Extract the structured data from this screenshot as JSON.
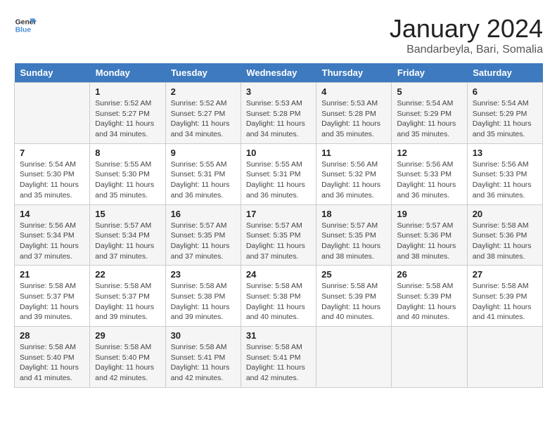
{
  "logo": {
    "line1": "General",
    "line2": "Blue"
  },
  "title": "January 2024",
  "location": "Bandarbeyla, Bari, Somalia",
  "days_header": [
    "Sunday",
    "Monday",
    "Tuesday",
    "Wednesday",
    "Thursday",
    "Friday",
    "Saturday"
  ],
  "weeks": [
    [
      {
        "day": "",
        "info": ""
      },
      {
        "day": "1",
        "info": "Sunrise: 5:52 AM\nSunset: 5:27 PM\nDaylight: 11 hours\nand 34 minutes."
      },
      {
        "day": "2",
        "info": "Sunrise: 5:52 AM\nSunset: 5:27 PM\nDaylight: 11 hours\nand 34 minutes."
      },
      {
        "day": "3",
        "info": "Sunrise: 5:53 AM\nSunset: 5:28 PM\nDaylight: 11 hours\nand 34 minutes."
      },
      {
        "day": "4",
        "info": "Sunrise: 5:53 AM\nSunset: 5:28 PM\nDaylight: 11 hours\nand 35 minutes."
      },
      {
        "day": "5",
        "info": "Sunrise: 5:54 AM\nSunset: 5:29 PM\nDaylight: 11 hours\nand 35 minutes."
      },
      {
        "day": "6",
        "info": "Sunrise: 5:54 AM\nSunset: 5:29 PM\nDaylight: 11 hours\nand 35 minutes."
      }
    ],
    [
      {
        "day": "7",
        "info": "Sunrise: 5:54 AM\nSunset: 5:30 PM\nDaylight: 11 hours\nand 35 minutes."
      },
      {
        "day": "8",
        "info": "Sunrise: 5:55 AM\nSunset: 5:30 PM\nDaylight: 11 hours\nand 35 minutes."
      },
      {
        "day": "9",
        "info": "Sunrise: 5:55 AM\nSunset: 5:31 PM\nDaylight: 11 hours\nand 36 minutes."
      },
      {
        "day": "10",
        "info": "Sunrise: 5:55 AM\nSunset: 5:31 PM\nDaylight: 11 hours\nand 36 minutes."
      },
      {
        "day": "11",
        "info": "Sunrise: 5:56 AM\nSunset: 5:32 PM\nDaylight: 11 hours\nand 36 minutes."
      },
      {
        "day": "12",
        "info": "Sunrise: 5:56 AM\nSunset: 5:33 PM\nDaylight: 11 hours\nand 36 minutes."
      },
      {
        "day": "13",
        "info": "Sunrise: 5:56 AM\nSunset: 5:33 PM\nDaylight: 11 hours\nand 36 minutes."
      }
    ],
    [
      {
        "day": "14",
        "info": "Sunrise: 5:56 AM\nSunset: 5:34 PM\nDaylight: 11 hours\nand 37 minutes."
      },
      {
        "day": "15",
        "info": "Sunrise: 5:57 AM\nSunset: 5:34 PM\nDaylight: 11 hours\nand 37 minutes."
      },
      {
        "day": "16",
        "info": "Sunrise: 5:57 AM\nSunset: 5:35 PM\nDaylight: 11 hours\nand 37 minutes."
      },
      {
        "day": "17",
        "info": "Sunrise: 5:57 AM\nSunset: 5:35 PM\nDaylight: 11 hours\nand 37 minutes."
      },
      {
        "day": "18",
        "info": "Sunrise: 5:57 AM\nSunset: 5:35 PM\nDaylight: 11 hours\nand 38 minutes."
      },
      {
        "day": "19",
        "info": "Sunrise: 5:57 AM\nSunset: 5:36 PM\nDaylight: 11 hours\nand 38 minutes."
      },
      {
        "day": "20",
        "info": "Sunrise: 5:58 AM\nSunset: 5:36 PM\nDaylight: 11 hours\nand 38 minutes."
      }
    ],
    [
      {
        "day": "21",
        "info": "Sunrise: 5:58 AM\nSunset: 5:37 PM\nDaylight: 11 hours\nand 39 minutes."
      },
      {
        "day": "22",
        "info": "Sunrise: 5:58 AM\nSunset: 5:37 PM\nDaylight: 11 hours\nand 39 minutes."
      },
      {
        "day": "23",
        "info": "Sunrise: 5:58 AM\nSunset: 5:38 PM\nDaylight: 11 hours\nand 39 minutes."
      },
      {
        "day": "24",
        "info": "Sunrise: 5:58 AM\nSunset: 5:38 PM\nDaylight: 11 hours\nand 40 minutes."
      },
      {
        "day": "25",
        "info": "Sunrise: 5:58 AM\nSunset: 5:39 PM\nDaylight: 11 hours\nand 40 minutes."
      },
      {
        "day": "26",
        "info": "Sunrise: 5:58 AM\nSunset: 5:39 PM\nDaylight: 11 hours\nand 40 minutes."
      },
      {
        "day": "27",
        "info": "Sunrise: 5:58 AM\nSunset: 5:39 PM\nDaylight: 11 hours\nand 41 minutes."
      }
    ],
    [
      {
        "day": "28",
        "info": "Sunrise: 5:58 AM\nSunset: 5:40 PM\nDaylight: 11 hours\nand 41 minutes."
      },
      {
        "day": "29",
        "info": "Sunrise: 5:58 AM\nSunset: 5:40 PM\nDaylight: 11 hours\nand 42 minutes."
      },
      {
        "day": "30",
        "info": "Sunrise: 5:58 AM\nSunset: 5:41 PM\nDaylight: 11 hours\nand 42 minutes."
      },
      {
        "day": "31",
        "info": "Sunrise: 5:58 AM\nSunset: 5:41 PM\nDaylight: 11 hours\nand 42 minutes."
      },
      {
        "day": "",
        "info": ""
      },
      {
        "day": "",
        "info": ""
      },
      {
        "day": "",
        "info": ""
      }
    ]
  ]
}
